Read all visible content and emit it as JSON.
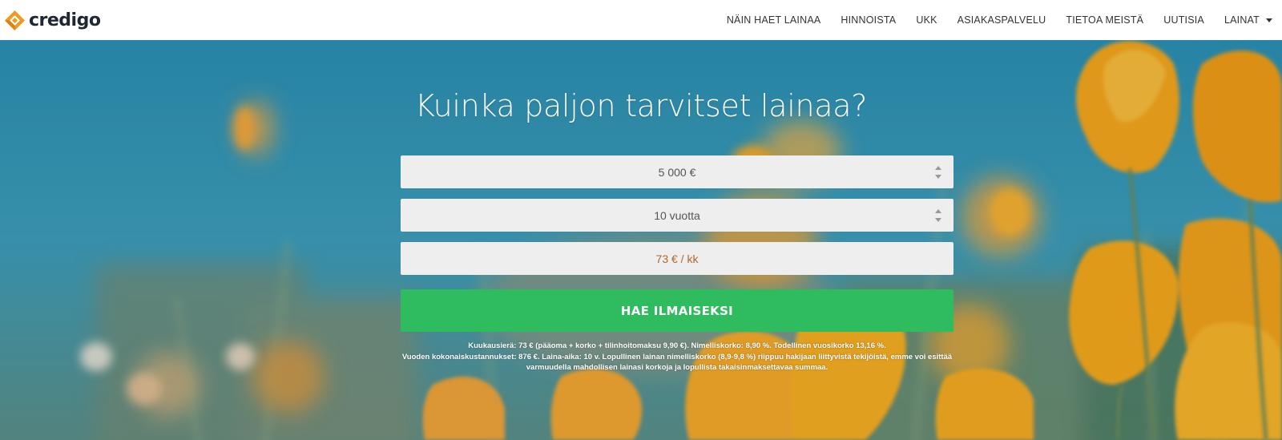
{
  "brand": {
    "name": "credigo",
    "logo_icon": "credigo-diamond-icon",
    "logo_color": "#f29a1f"
  },
  "nav": {
    "items": [
      {
        "label": "NÄIN HAET LAINAA"
      },
      {
        "label": "HINNOISTA"
      },
      {
        "label": "UKK"
      },
      {
        "label": "ASIAKASPALVELU"
      },
      {
        "label": "TIETOA MEISTÄ"
      },
      {
        "label": "UUTISIA"
      },
      {
        "label": "LAINAT"
      }
    ]
  },
  "hero": {
    "title": "Kuinka paljon tarvitset lainaa?",
    "amount_value": "5 000 €",
    "term_value": "10 vuotta",
    "monthly_value": "73 € / kk",
    "cta_label": "HAE ILMAISEKSI",
    "disclaimer_line1": "Kuukausierä: 73 € (pääoma + korko + tilinhoitomaksu 9,90 €). Nimelliskorko: 8,90 %. Todellinen vuosikorko 13,16 %.",
    "disclaimer_line2": "Vuoden kokonaiskustannukset: 876 €. Laina-aika: 10 v. Lopullinen lainan nimelliskorko (8,9-9,8 %) riippuu hakijaan liittyvistä tekijöistä, emme voi esittää varmuudella mahdollisen lainasi korkoja ja lopullista takaisinmaksettavaa summaa."
  },
  "colors": {
    "cta_green": "#2ebc5f",
    "monthly_text": "#b2672c",
    "field_bg": "#eeeeee",
    "sky_blue": "#2c90b2",
    "flower_orange": "#f2a51c"
  }
}
